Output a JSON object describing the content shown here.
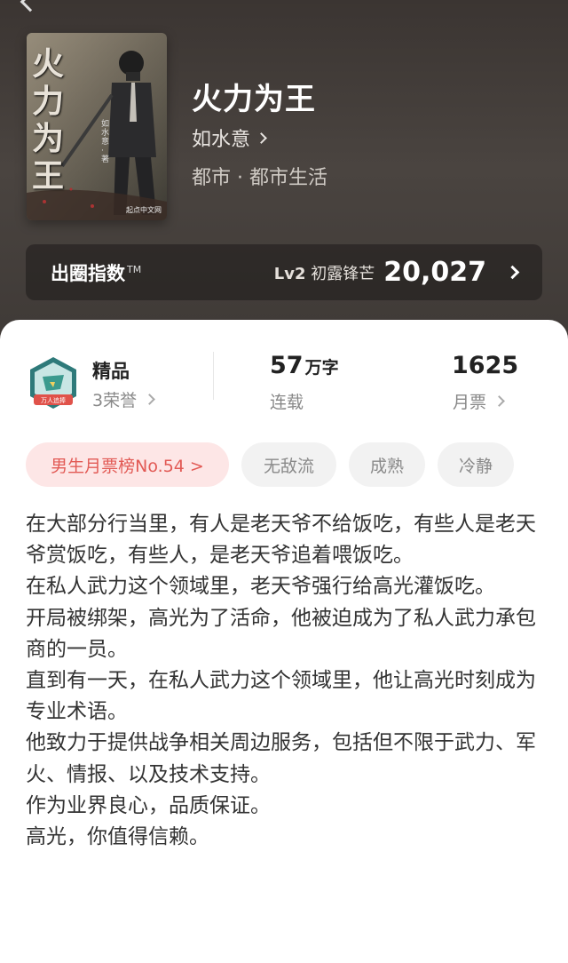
{
  "book": {
    "title": "火力为王",
    "author": "如水意",
    "category": "都市 · 都市生活"
  },
  "cover": {
    "title_text": "火力为王",
    "author_text": "如水意 · 著",
    "publisher_text": "起点中文网"
  },
  "index": {
    "label": "出圈指数",
    "tm": "TM",
    "level": "Lv2",
    "level_name": "初露锋芒",
    "value": "20,027"
  },
  "stats": {
    "quality": {
      "title": "精品",
      "honors": "3荣誉",
      "badge_text": "万人追捧"
    },
    "words": {
      "value": "57",
      "unit": "万字",
      "status": "连载"
    },
    "tickets": {
      "value": "1625",
      "label": "月票"
    }
  },
  "tags": [
    "男生月票榜No.54 >",
    "无敌流",
    "成熟",
    "冷静"
  ],
  "description": [
    "在大部分行当里，有人是老天爷不给饭吃，有些人是老天爷赏饭吃，有些人，是老天爷追着喂饭吃。",
    "在私人武力这个领域里，老天爷强行给高光灌饭吃。",
    "开局被绑架，高光为了活命，他被迫成为了私人武力承包商的一员。",
    "直到有一天，在私人武力这个领域里，他让高光时刻成为专业术语。",
    "他致力于提供战争相关周边服务，包括但不限于武力、军火、情报、以及技术支持。",
    "作为业界良心，品质保证。",
    "高光，你值得信赖。"
  ],
  "colors": {
    "header_bg": "#3f3a37",
    "rank_tag_bg": "#fde6e6",
    "rank_tag_text": "#e25a55",
    "tag_bg": "#f2f2f2"
  }
}
